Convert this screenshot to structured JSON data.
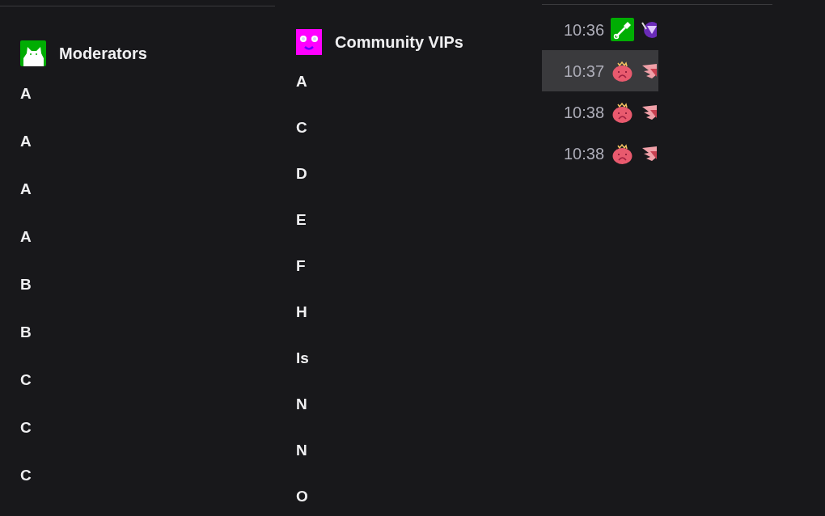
{
  "moderators": {
    "title": "Moderators",
    "names": [
      "A",
      "A",
      "A",
      "A",
      "B",
      "B",
      "C",
      "C",
      "C"
    ]
  },
  "vips": {
    "title": "Community VIPs",
    "names": [
      "A",
      "C",
      "D",
      "E",
      "F",
      "H",
      "Is",
      "N",
      "N",
      "O"
    ]
  },
  "chat": {
    "rows": [
      {
        "time": "10:36",
        "selected": false,
        "badges": [
          {
            "kind": "shovel"
          },
          {
            "kind": "gem"
          }
        ]
      },
      {
        "time": "10:37",
        "selected": true,
        "badges": [
          {
            "kind": "blob"
          },
          {
            "kind": "wings"
          }
        ]
      },
      {
        "time": "10:38",
        "selected": false,
        "badges": [
          {
            "kind": "blob"
          },
          {
            "kind": "wings"
          }
        ]
      },
      {
        "time": "10:38",
        "selected": false,
        "badges": [
          {
            "kind": "blob"
          },
          {
            "kind": "wings"
          }
        ]
      }
    ]
  }
}
